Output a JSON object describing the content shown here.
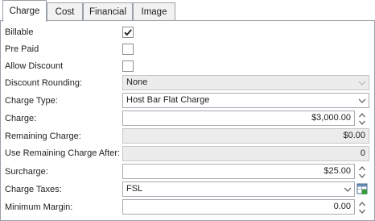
{
  "tabs": [
    "Charge",
    "Cost",
    "Financial",
    "Image"
  ],
  "form": {
    "billable": {
      "label": "Billable",
      "checked": true
    },
    "pre_paid": {
      "label": "Pre Paid",
      "checked": false
    },
    "allow_discount": {
      "label": "Allow Discount",
      "checked": false
    },
    "discount_rounding": {
      "label": "Discount Rounding:",
      "value": "None"
    },
    "charge_type": {
      "label": "Charge Type:",
      "value": "Host Bar Flat Charge"
    },
    "charge": {
      "label": "Charge:",
      "value": "$3,000.00"
    },
    "remaining_charge": {
      "label": "Remaining Charge:",
      "value": "$0.00"
    },
    "use_remaining_after": {
      "label": "Use Remaining Charge After:",
      "value": "0"
    },
    "surcharge": {
      "label": "Surcharge:",
      "value": "$25.00"
    },
    "charge_taxes": {
      "label": "Charge Taxes:",
      "value": "FSL"
    },
    "minimum_margin": {
      "label": "Minimum Margin:",
      "value": "0.00"
    }
  },
  "colors": {
    "check": "#1e1e1e",
    "border": "#9aa1a8",
    "readonly_bg": "#ececec",
    "grid_icon_green": "#3d9c3a"
  }
}
